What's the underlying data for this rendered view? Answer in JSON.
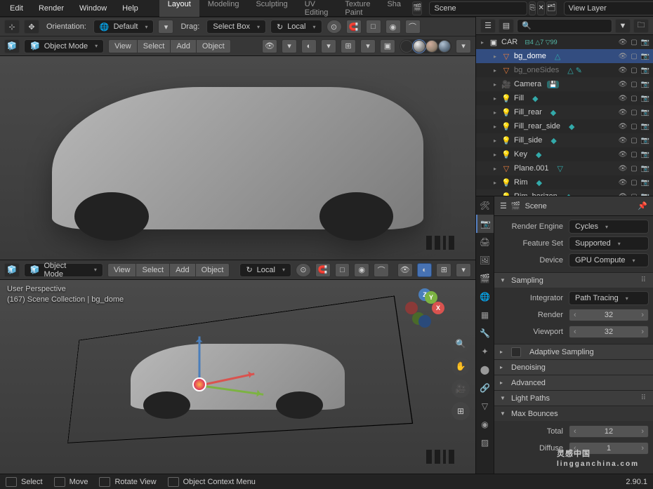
{
  "menu": {
    "items": [
      "Edit",
      "Render",
      "Window",
      "Help"
    ]
  },
  "workspace_tabs": [
    "Layout",
    "Modeling",
    "Sculpting",
    "UV Editing",
    "Texture Paint",
    "Sha"
  ],
  "workspace_active": 0,
  "scene_name": "Scene",
  "view_layer": "View Layer",
  "tool_header": {
    "orientation_label": "Orientation:",
    "orientation_value": "Default",
    "drag_label": "Drag:",
    "drag_value": "Select Box",
    "transform_value": "Local"
  },
  "vp_top_header": {
    "mode": "Object Mode",
    "menus": [
      "View",
      "Select",
      "Add",
      "Object"
    ]
  },
  "vp_bot_header": {
    "mode": "Object Mode",
    "menus": [
      "View",
      "Select",
      "Add",
      "Object"
    ],
    "orientation": "Local"
  },
  "vp_bot_overlay": {
    "line1": "User Perspective",
    "line2": "(167) Scene Collection | bg_dome"
  },
  "outliner_header": {
    "search_placeholder": ""
  },
  "outliner": [
    {
      "name": "CAR",
      "type": "collection",
      "icon": "▣",
      "badges": "⊟4 △7 ▽99",
      "sel": false,
      "depth": 0,
      "tw": "▸"
    },
    {
      "name": "bg_dome",
      "type": "mesh",
      "icon": "▽",
      "sel": true,
      "depth": 1,
      "tw": "▸",
      "data": "△"
    },
    {
      "name": "bg_oneSides",
      "type": "mesh",
      "icon": "▽",
      "sel": false,
      "muted": true,
      "depth": 1,
      "tw": "▸",
      "data": "△ ✎"
    },
    {
      "name": "Camera",
      "type": "camera",
      "icon": "🎥",
      "sel": false,
      "depth": 1,
      "tw": "▸",
      "disk": true
    },
    {
      "name": "Fill",
      "type": "light",
      "icon": "💡",
      "sel": false,
      "depth": 1,
      "tw": "▸",
      "data": "◆"
    },
    {
      "name": "Fill_rear",
      "type": "light",
      "icon": "💡",
      "sel": false,
      "depth": 1,
      "tw": "▸",
      "data": "◆"
    },
    {
      "name": "Fill_rear_side",
      "type": "light",
      "icon": "💡",
      "sel": false,
      "depth": 1,
      "tw": "▸",
      "data": "◆"
    },
    {
      "name": "Fill_side",
      "type": "light",
      "icon": "💡",
      "sel": false,
      "depth": 1,
      "tw": "▸",
      "data": "◆"
    },
    {
      "name": "Key",
      "type": "light",
      "icon": "💡",
      "sel": false,
      "depth": 1,
      "tw": "▸",
      "data": "◆"
    },
    {
      "name": "Plane.001",
      "type": "mesh",
      "icon": "▽",
      "sel": false,
      "depth": 1,
      "tw": "▸",
      "data": "▽"
    },
    {
      "name": "Rim",
      "type": "light",
      "icon": "💡",
      "sel": false,
      "depth": 1,
      "tw": "▸",
      "data": "◆"
    },
    {
      "name": "Rim_horizon",
      "type": "light",
      "icon": "💡",
      "sel": false,
      "depth": 1,
      "tw": "▸",
      "data": "◆"
    }
  ],
  "props": {
    "context": "Scene",
    "render_engine_label": "Render Engine",
    "render_engine": "Cycles",
    "feature_set_label": "Feature Set",
    "feature_set": "Supported",
    "device_label": "Device",
    "device": "GPU Compute",
    "sampling_panel": "Sampling",
    "integrator_label": "Integrator",
    "integrator": "Path Tracing",
    "render_label": "Render",
    "render_samples": "32",
    "viewport_label": "Viewport",
    "viewport_samples": "32",
    "adaptive": "Adaptive Sampling",
    "denoising": "Denoising",
    "advanced": "Advanced",
    "light_paths": "Light Paths",
    "max_bounces": "Max Bounces",
    "total_label": "Total",
    "total_val": "12",
    "diffuse_label": "Diffuse",
    "diffuse_val": "1"
  },
  "statusbar": {
    "select": "Select",
    "move": "Move",
    "rotate": "Rotate View",
    "context": "Object Context Menu",
    "version": "2.90.1"
  },
  "watermark": {
    "main": "灵感中国",
    "sub": "lingganchina.com"
  }
}
